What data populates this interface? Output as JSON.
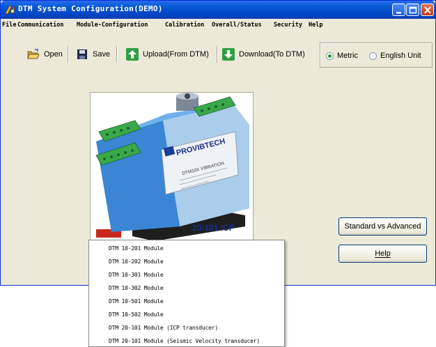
{
  "window": {
    "title": "DTM System Configuration(DEMO)"
  },
  "menubar": {
    "items": [
      "File",
      "Communication",
      "Module-Configuration",
      "Calibration",
      "Overall/Status",
      "Security",
      "Help"
    ]
  },
  "toolbar": {
    "open_label": "Open",
    "save_label": "Save",
    "upload_label": "Upload(From DTM)",
    "download_label": "Download(To DTM)",
    "units": {
      "metric_label": "Metric",
      "english_label": "English Unit",
      "selected": "Metric"
    }
  },
  "product": {
    "caption": "20-101 ICP",
    "brand": "PROVIBTECH",
    "module_label": "DTM10X VIBRATION"
  },
  "buttons": {
    "standard_vs_advanced": "Standard vs Advanced",
    "help_label": "Help"
  },
  "module_menu": {
    "items": [
      "DTM 10-201 Module",
      "DTM 10-202 Module",
      "DTM 10-301 Module",
      "DTM 10-302 Module",
      "DTM 10-501 Module",
      "DTM 10-502 Module",
      "DTM 20-101 Module (ICP transducer)",
      "DTM 20-101 Module (Seismic Velocity transducer)"
    ]
  },
  "colors": {
    "titlebar": "#0a5bd6",
    "window_bg": "#ece9d8",
    "module_body": "#3a86d4",
    "terminal_green": "#3aa84a",
    "caption": "#1a2f8f"
  }
}
